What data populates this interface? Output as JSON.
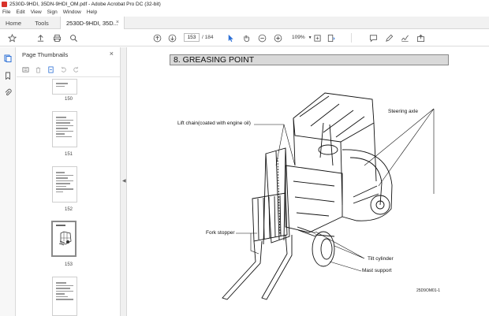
{
  "window": {
    "title": "2530D-9HDI, 35DN-9HDI_OM.pdf - Adobe Acrobat Pro DC (32-bit)"
  },
  "menu": [
    "File",
    "Edit",
    "View",
    "Sign",
    "Window",
    "Help"
  ],
  "tabs": {
    "home": "Home",
    "tools": "Tools",
    "document": "2530D-9HDI, 35D...",
    "close_glyph": "×"
  },
  "toolbar": {
    "current_page": "153",
    "total_pages": "/ 184",
    "zoom": "109%",
    "icons": [
      "star-icon",
      "upload-icon",
      "print-icon",
      "search-icon",
      "page-up-icon",
      "page-down-icon",
      "select-pointer-icon",
      "hand-icon",
      "zoom-out-icon",
      "zoom-in-icon",
      "fit-page-icon",
      "scroll-mode-icon",
      "comment-icon",
      "highlight-icon",
      "sign-icon",
      "share-icon"
    ]
  },
  "thumbnails_panel": {
    "title": "Page Thumbnails",
    "close_glyph": "×",
    "pages": [
      {
        "label": "150",
        "selected": false
      },
      {
        "label": "151",
        "selected": false
      },
      {
        "label": "152",
        "selected": false
      },
      {
        "label": "153",
        "selected": true
      },
      {
        "label": "",
        "selected": false
      }
    ]
  },
  "document": {
    "heading": "8. GREASING POINT",
    "callouts": {
      "lift_chain": "Lift chain(coated with engine oil)",
      "steering_axle": "Steering axle",
      "fork_stopper": "Fork stopper",
      "tilt_cylinder": "Tilt cylinder",
      "mast_support": "Mast support"
    },
    "figure_code": "25D9OM01-1"
  },
  "colors": {
    "accent_blue": "#2b6fd6",
    "acrobat_red": "#d8322a"
  }
}
